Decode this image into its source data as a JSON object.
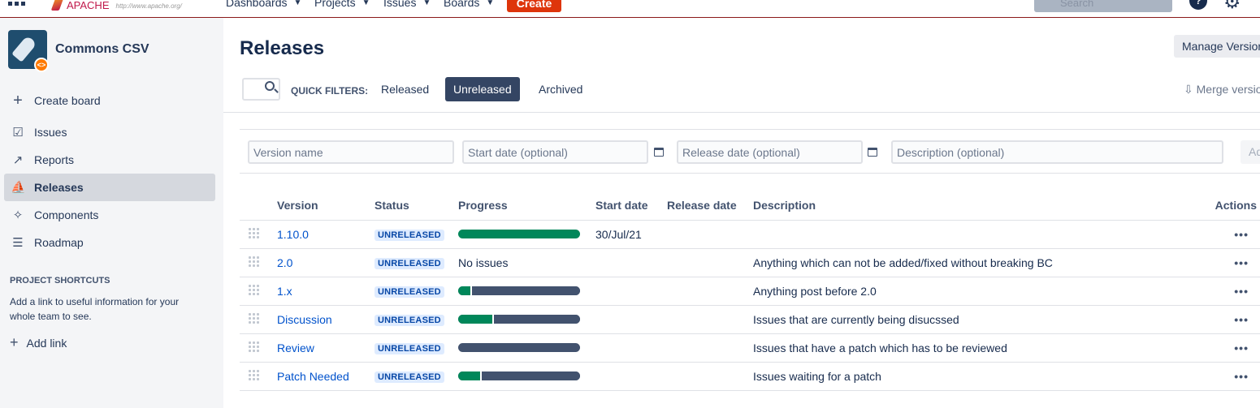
{
  "topbar": {
    "logo_name": "APACHE",
    "logo_url": "http://www.apache.org/",
    "nav": [
      "Dashboards",
      "Projects",
      "Issues",
      "Boards"
    ],
    "create_label": "Create",
    "search_placeholder": "Search",
    "help_glyph": "?",
    "settings_glyph": "⚙"
  },
  "sidebar": {
    "project_name": "Commons CSV",
    "items": [
      {
        "label": "Create board",
        "icon": "plus-icon"
      },
      {
        "label": "Issues",
        "icon": "issues-icon"
      },
      {
        "label": "Reports",
        "icon": "reports-icon"
      },
      {
        "label": "Releases",
        "icon": "releases-icon",
        "active": true
      },
      {
        "label": "Components",
        "icon": "components-icon"
      },
      {
        "label": "Roadmap",
        "icon": "roadmap-icon"
      }
    ],
    "shortcuts_title": "PROJECT SHORTCUTS",
    "shortcuts_desc": "Add a link to useful information for your whole team to see.",
    "add_link": "Add link"
  },
  "main": {
    "title": "Releases",
    "manage_versions": "Manage Versions",
    "quick_filters_label": "QUICK FILTERS:",
    "filters": [
      "Released",
      "Unreleased",
      "Archived"
    ],
    "active_filter": "Unreleased",
    "merge_versions": "Merge versions",
    "form": {
      "version_placeholder": "Version name",
      "start_placeholder": "Start date (optional)",
      "release_placeholder": "Release date (optional)",
      "description_placeholder": "Description (optional)",
      "add_label": "Add"
    },
    "columns": [
      "Version",
      "Status",
      "Progress",
      "Start date",
      "Release date",
      "Description",
      "Actions"
    ],
    "rows": [
      {
        "version": "1.10.0",
        "status": "UNRELEASED",
        "progress_done": 1.0,
        "progress_text": "",
        "start_date": "30/Jul/21",
        "release_date": "",
        "description": ""
      },
      {
        "version": "2.0",
        "status": "UNRELEASED",
        "progress_done": null,
        "progress_text": "No issues",
        "start_date": "",
        "release_date": "",
        "description": "Anything which can not be added/fixed without breaking BC"
      },
      {
        "version": "1.x",
        "status": "UNRELEASED",
        "progress_done": 0.1,
        "progress_text": "",
        "start_date": "",
        "release_date": "",
        "description": "Anything post before 2.0"
      },
      {
        "version": "Discussion",
        "status": "UNRELEASED",
        "progress_done": 0.28,
        "progress_text": "",
        "start_date": "",
        "release_date": "",
        "description": "Issues that are currently being disucssed"
      },
      {
        "version": "Review",
        "status": "UNRELEASED",
        "progress_done": 0.0,
        "progress_text": "",
        "start_date": "",
        "release_date": "",
        "description": "Issues that have a patch which has to be reviewed"
      },
      {
        "version": "Patch Needed",
        "status": "UNRELEASED",
        "progress_done": 0.18,
        "progress_text": "",
        "start_date": "",
        "release_date": "",
        "description": "Issues waiting for a patch"
      }
    ],
    "actions_glyph": "•••"
  },
  "colors": {
    "accent": "#0052cc",
    "create": "#de350b",
    "done": "#00875a",
    "todo": "#42526e",
    "lozenge_bg": "#deebff"
  }
}
